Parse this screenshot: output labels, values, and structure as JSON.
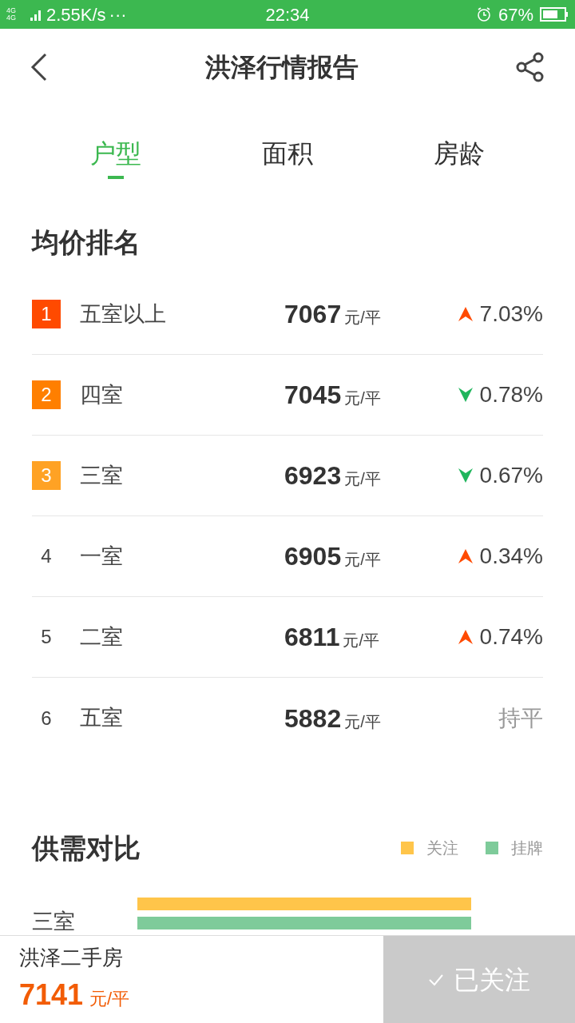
{
  "status_bar": {
    "network": "4G 4G",
    "speed": "2.55K/s",
    "dots": "···",
    "time": "22:34",
    "battery": "67%"
  },
  "header": {
    "title": "洪泽行情报告"
  },
  "tabs": [
    {
      "label": "户型",
      "selected": true
    },
    {
      "label": "面积",
      "selected": false
    },
    {
      "label": "房龄",
      "selected": false
    }
  ],
  "ranking": {
    "title": "均价排名",
    "rows": [
      {
        "rank": "1",
        "color": "#ff4a00",
        "name": "五室以上",
        "price": "7067",
        "unit": "元/平",
        "kind": "up",
        "change": "7.03%"
      },
      {
        "rank": "2",
        "color": "#ff7f00",
        "name": "四室",
        "price": "7045",
        "unit": "元/平",
        "kind": "down",
        "change": "0.78%"
      },
      {
        "rank": "3",
        "color": "#ffa224",
        "name": "三室",
        "price": "6923",
        "unit": "元/平",
        "kind": "down",
        "change": "0.67%"
      },
      {
        "rank": "4",
        "name": "一室",
        "price": "6905",
        "unit": "元/平",
        "kind": "up",
        "change": "0.34%"
      },
      {
        "rank": "5",
        "name": "二室",
        "price": "6811",
        "unit": "元/平",
        "kind": "up",
        "change": "0.74%"
      },
      {
        "rank": "6",
        "name": "五室",
        "price": "5882",
        "unit": "元/平",
        "kind": "flat",
        "change": "持平"
      }
    ]
  },
  "supply": {
    "title": "供需对比",
    "legend": [
      {
        "label": "关注",
        "color": "#ffc54a"
      },
      {
        "label": "挂牌",
        "color": "#7ecb9a"
      }
    ],
    "rows": [
      {
        "label": "三室"
      }
    ]
  },
  "footer": {
    "name": "洪泽二手房",
    "price": "7141",
    "unit": "元/平",
    "follow": {
      "label": "已关注",
      "followed": true
    }
  }
}
